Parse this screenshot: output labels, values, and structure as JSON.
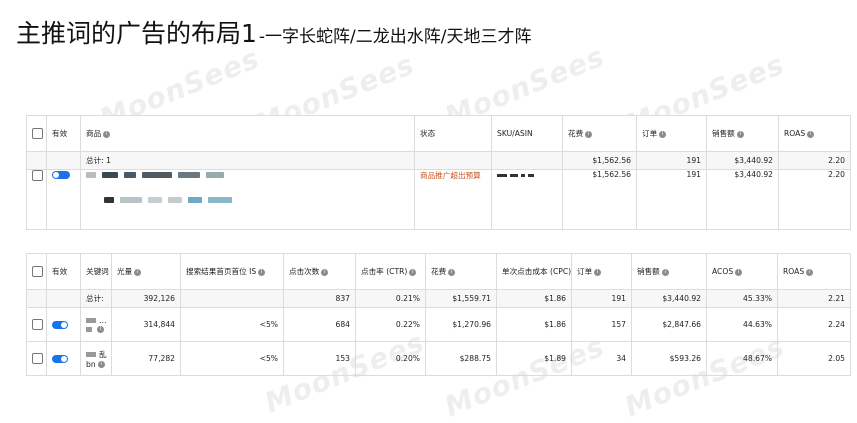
{
  "page_title": "主推词的广告的布局1",
  "page_subtitle": "-一字长蛇阵/二龙出水阵/天地三才阵",
  "colors": {
    "accent": "#1a73e8",
    "status_orange": "#c7511f",
    "border": "#dcdcdc",
    "total_bg": "#f7f7f7"
  },
  "watermark": "MoonSees",
  "table1": {
    "headers": {
      "enabled": "有效",
      "product": "商品",
      "status": "状态",
      "sku": "SKU/ASIN",
      "spend": "花费",
      "orders": "订单",
      "sales": "销售额",
      "roas": "ROAS"
    },
    "total": {
      "label": "总计: 1",
      "spend": "$1,562.56",
      "orders": "191",
      "sales": "$3,440.92",
      "roas": "2.20"
    },
    "row": {
      "status": "商品推广超出预算",
      "spend": "$1,562.56",
      "orders": "191",
      "sales": "$3,440.92",
      "roas": "2.20"
    }
  },
  "table2": {
    "headers": {
      "enabled": "有效",
      "keyword": "关键词",
      "impressions": "光量",
      "search_top_is": "搜索结果首页首位 IS",
      "clicks": "点击次数",
      "ctr": "点击率 (CTR)",
      "spend": "花费",
      "cpc": "单次点击成本 (CPC)",
      "orders": "订单",
      "sales": "销售额",
      "acos": "ACOS",
      "roas": "ROAS"
    },
    "total": {
      "label": "总计:",
      "impressions": "392,126",
      "clicks": "837",
      "ctr": "0.21%",
      "spend": "$1,559.71",
      "cpc": "$1.86",
      "orders": "191",
      "sales": "$3,440.92",
      "acos": "45.33%",
      "roas": "2.21"
    },
    "rows": [
      {
        "kw_fragment": "…",
        "impressions": "314,844",
        "top_is": "<5%",
        "clicks": "684",
        "ctr": "0.22%",
        "spend": "$1,270.96",
        "cpc": "$1.86",
        "orders": "157",
        "sales": "$2,847.66",
        "acos": "44.63%",
        "roas": "2.24"
      },
      {
        "kw_fragment": "乱",
        "kw_fragment2": "bn",
        "impressions": "77,282",
        "top_is": "<5%",
        "clicks": "153",
        "ctr": "0.20%",
        "spend": "$288.75",
        "cpc": "$1.89",
        "orders": "34",
        "sales": "$593.26",
        "acos": "48.67%",
        "roas": "2.05"
      }
    ]
  }
}
